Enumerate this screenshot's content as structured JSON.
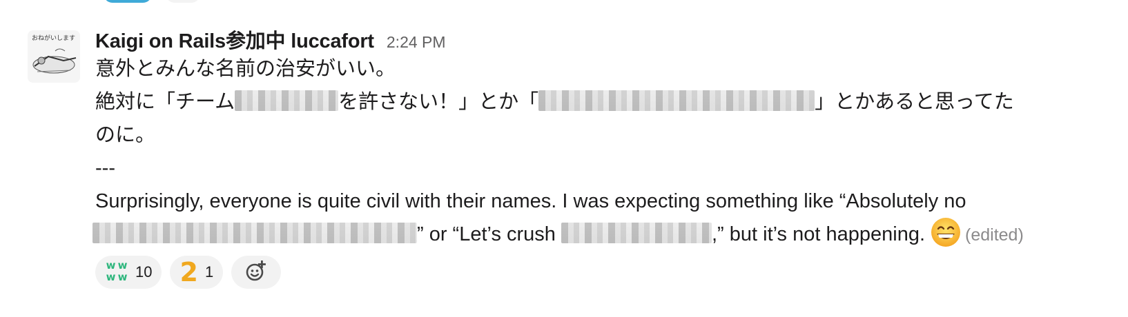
{
  "message": {
    "username": "Kaigi on Rails参加中 luccafort",
    "timestamp": "2:24 PM",
    "lines": [
      "意外とみんな名前の治安がいい。",
      "絶対に「チーム",
      "を許さない！」とか「",
      "」とかあると思ってた",
      "のに。",
      "---",
      "Surprisingly, everyone is quite civil with their names. I was expecting something like “Absolutely no",
      "” or “Let’s crush",
      ",” but it’s not happening."
    ],
    "emoji": "grinning-face-with-smiling-eyes",
    "edited_label": "(edited)"
  },
  "reactions": [
    {
      "icon": "ww-icon",
      "glyph": "ww",
      "count": "10"
    },
    {
      "icon": "two-icon",
      "glyph": "2",
      "count": "1"
    }
  ],
  "colors": {
    "text": "#1d1c1d",
    "timestamp": "#616061",
    "edited": "#8b8a8b",
    "reaction_bg": "#f2f2f2",
    "ww_green": "#2eb67d",
    "two_orange": "#f0a81f"
  }
}
